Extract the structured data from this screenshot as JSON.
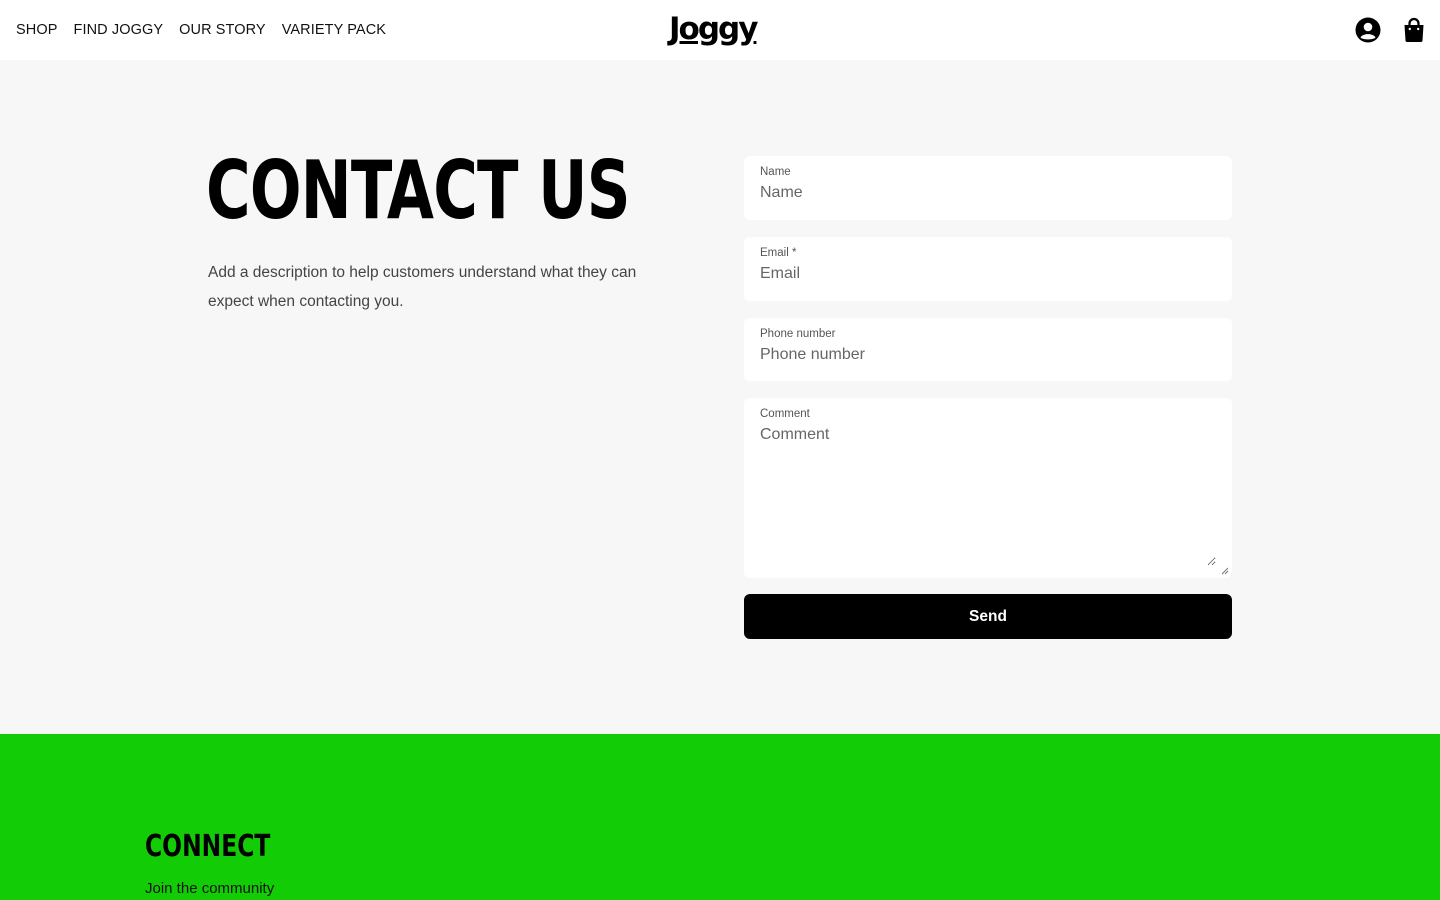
{
  "header": {
    "nav": [
      "SHOP",
      "FIND JOGGY",
      "OUR STORY",
      "VARIETY PACK"
    ],
    "logo": "Joggy",
    "icons": [
      "account-icon",
      "cart-icon"
    ]
  },
  "main": {
    "title": "CONTACT US",
    "description": "Add a description to help customers understand what they can expect when contacting you."
  },
  "form": {
    "name_label": "Name",
    "name_placeholder": "Name",
    "email_label": "Email *",
    "email_placeholder": "Email",
    "phone_label": "Phone number",
    "phone_placeholder": "Phone number",
    "comment_label": "Comment",
    "comment_placeholder": "Comment",
    "send_label": "Send"
  },
  "footer": {
    "heading": "CONNECT",
    "subtext": "Join the community",
    "background": "#12cc05"
  }
}
